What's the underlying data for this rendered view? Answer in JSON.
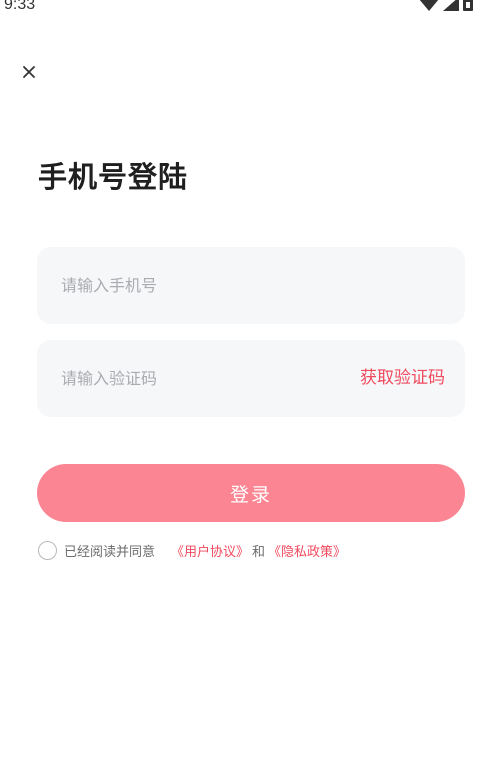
{
  "status_bar": {
    "time": "9:33"
  },
  "header": {
    "close_icon": "close-icon"
  },
  "page": {
    "title": "手机号登陆"
  },
  "phone_input": {
    "placeholder": "请输入手机号",
    "value": ""
  },
  "code_input": {
    "placeholder": "请输入验证码",
    "value": "",
    "get_code_label": "获取验证码"
  },
  "login_button": {
    "label": "登录"
  },
  "agreement": {
    "checked": false,
    "text": "已经阅读并同意",
    "user_agreement": "《用户协议》",
    "and": "和",
    "privacy_policy": "《隐私政策》"
  },
  "colors": {
    "accent": "#f04a5e",
    "button": "#fb8592",
    "input_bg": "#f6f7f9"
  }
}
